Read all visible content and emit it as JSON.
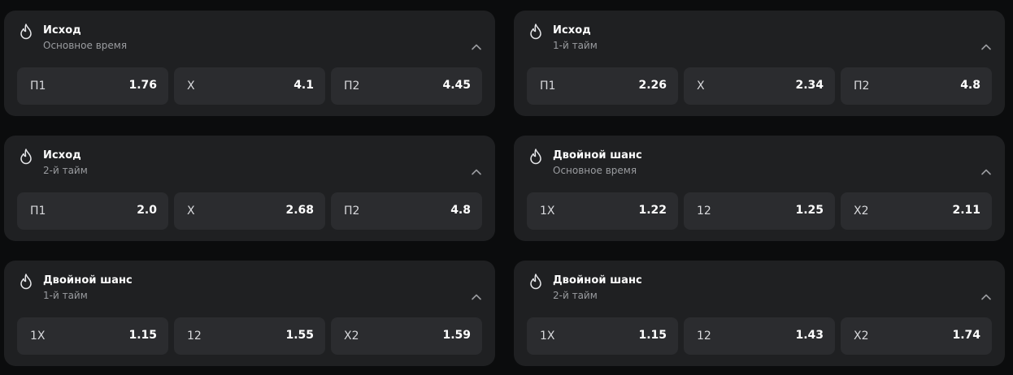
{
  "markets": [
    {
      "title": "Исход",
      "subtitle": "Основное время",
      "outcomes": [
        {
          "label": "П1",
          "odd": "1.76"
        },
        {
          "label": "X",
          "odd": "4.1"
        },
        {
          "label": "П2",
          "odd": "4.45"
        }
      ]
    },
    {
      "title": "Исход",
      "subtitle": "1-й тайм",
      "outcomes": [
        {
          "label": "П1",
          "odd": "2.26"
        },
        {
          "label": "X",
          "odd": "2.34"
        },
        {
          "label": "П2",
          "odd": "4.8"
        }
      ]
    },
    {
      "title": "Исход",
      "subtitle": "2-й тайм",
      "outcomes": [
        {
          "label": "П1",
          "odd": "2.0"
        },
        {
          "label": "X",
          "odd": "2.68"
        },
        {
          "label": "П2",
          "odd": "4.8"
        }
      ]
    },
    {
      "title": "Двойной шанс",
      "subtitle": "Основное время",
      "outcomes": [
        {
          "label": "1X",
          "odd": "1.22"
        },
        {
          "label": "12",
          "odd": "1.25"
        },
        {
          "label": "X2",
          "odd": "2.11"
        }
      ]
    },
    {
      "title": "Двойной шанс",
      "subtitle": "1-й тайм",
      "outcomes": [
        {
          "label": "1X",
          "odd": "1.15"
        },
        {
          "label": "12",
          "odd": "1.55"
        },
        {
          "label": "X2",
          "odd": "1.59"
        }
      ]
    },
    {
      "title": "Двойной шанс",
      "subtitle": "2-й тайм",
      "outcomes": [
        {
          "label": "1X",
          "odd": "1.15"
        },
        {
          "label": "12",
          "odd": "1.43"
        },
        {
          "label": "X2",
          "odd": "1.74"
        }
      ]
    }
  ],
  "icons": {
    "header": "flame-icon",
    "collapse": "chevron-up-icon"
  },
  "colors": {
    "background": "#0b0c0d",
    "card": "#1f2022",
    "odd_button": "#2b2c2f",
    "text": "#ffffff",
    "muted_text": "#9a9ca0"
  }
}
